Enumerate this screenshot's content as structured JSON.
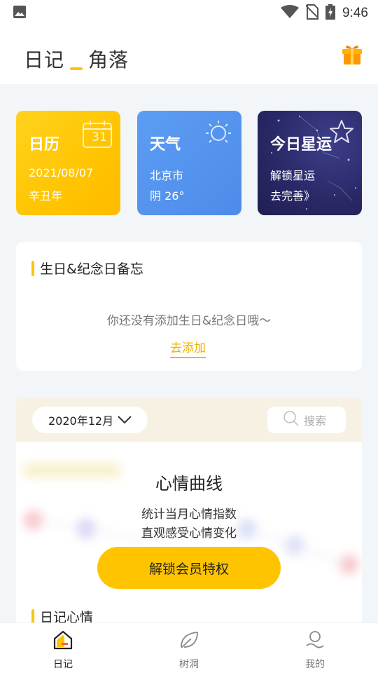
{
  "status_bar": {
    "time": "9:46",
    "icons": [
      "gallery-icon",
      "wifi-icon",
      "no-sim-icon",
      "battery-charging-icon"
    ]
  },
  "header": {
    "title_left": "日记",
    "title_right": "角落",
    "gift_icon": "gift-icon"
  },
  "cards": {
    "calendar": {
      "title": "日历",
      "date": "2021/08/07",
      "lunar_year": "辛丑年",
      "icon_day": "31"
    },
    "weather": {
      "title": "天气",
      "city": "北京市",
      "condition": "阴 26°"
    },
    "horoscope": {
      "title": "今日星运",
      "line1": "解锁星运",
      "line2": "去完善》"
    }
  },
  "birthday_section": {
    "title": "生日&纪念日备忘",
    "empty_text": "你还没有添加生日&纪念日哦～",
    "add_link": "去添加"
  },
  "mood_section": {
    "month": "2020年12月",
    "search_placeholder": "搜索",
    "title": "心情曲线",
    "desc_line1": "统计当月心情指数",
    "desc_line2": "直观感受心情变化",
    "unlock_button": "解锁会员特权",
    "next_section_title": "日记心情"
  },
  "bottom_nav": {
    "items": [
      {
        "label": "日记",
        "icon": "home-icon",
        "active": true
      },
      {
        "label": "树洞",
        "icon": "leaf-icon",
        "active": false
      },
      {
        "label": "我的",
        "icon": "user-icon",
        "active": false
      }
    ]
  },
  "colors": {
    "accent": "#ffc400",
    "calendar_card": "#ffc400",
    "weather_card": "#5595ef",
    "horoscope_card": "#2a2968",
    "background": "#f2f6f8"
  }
}
